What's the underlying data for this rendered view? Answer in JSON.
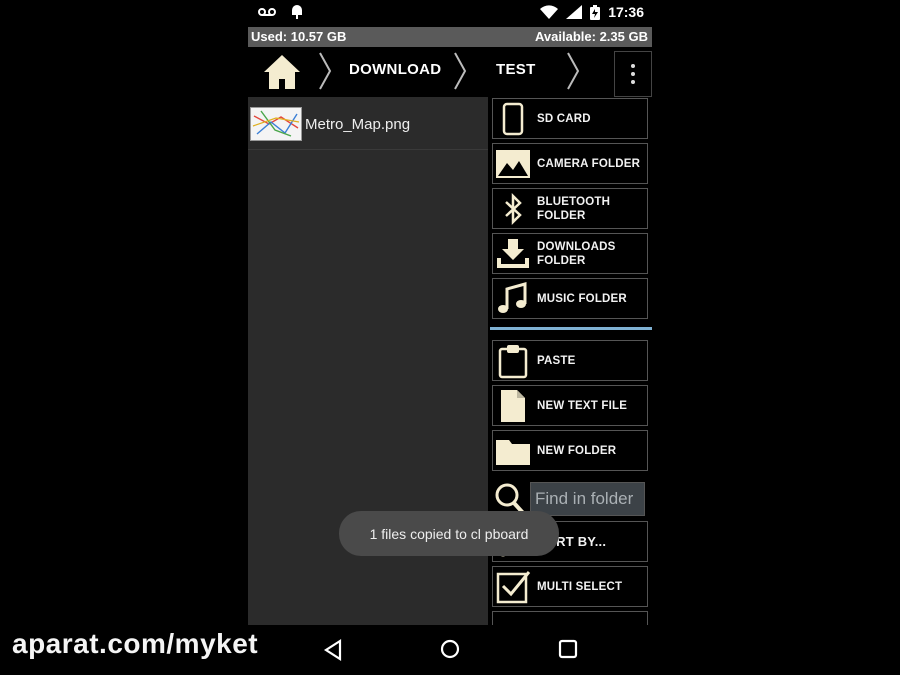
{
  "status_bar": {
    "time": "17:36"
  },
  "storage": {
    "used": "Used: 10.57 GB",
    "available": "Available: 2.35 GB"
  },
  "breadcrumb": {
    "items": [
      "DOWNLOAD",
      "TEST"
    ]
  },
  "files": [
    {
      "name": "Metro_Map.png"
    }
  ],
  "menu": {
    "locations": [
      {
        "label": "SD CARD",
        "icon": "sd-card-icon"
      },
      {
        "label": "CAMERA FOLDER",
        "icon": "image-icon"
      },
      {
        "label": "BLUETOOTH FOLDER",
        "icon": "bluetooth-icon"
      },
      {
        "label": "DOWNLOADS FOLDER",
        "icon": "download-icon"
      },
      {
        "label": "MUSIC FOLDER",
        "icon": "music-icon"
      }
    ],
    "actions": [
      {
        "label": "PASTE",
        "icon": "clipboard-icon"
      },
      {
        "label": "NEW TEXT FILE",
        "icon": "file-icon"
      },
      {
        "label": "NEW FOLDER",
        "icon": "folder-icon"
      },
      {
        "label": "SORT BY...",
        "icon": "sort-icon"
      },
      {
        "label": "MULTI SELECT",
        "icon": "checkbox-icon"
      }
    ],
    "find_placeholder": "Find in folder"
  },
  "toast": "1 files copied to cl pboard",
  "watermark": "aparat.com/myket",
  "colors": {
    "accent": "#7fb1d3",
    "icon": "#f4ecd0",
    "pane": "#2b2b2b"
  }
}
